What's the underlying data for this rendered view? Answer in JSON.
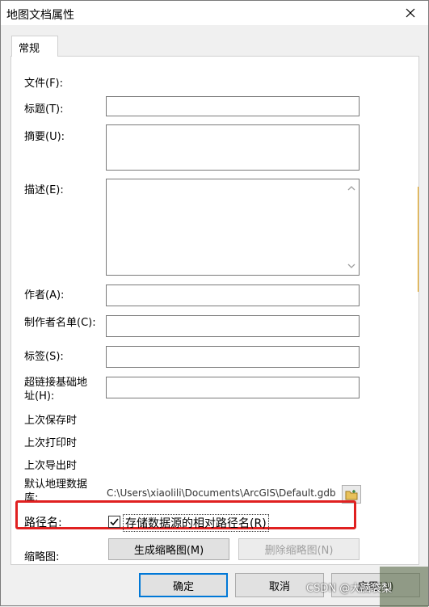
{
  "window": {
    "title": "地图文档属性"
  },
  "tabs": [
    {
      "label": "常规"
    }
  ],
  "form": {
    "file_label": "文件(F):",
    "title_label": "标题(T):",
    "title_value": "",
    "summary_label": "摘要(U):",
    "summary_value": "",
    "description_label": "描述(E):",
    "description_value": "",
    "author_label": "作者(A):",
    "author_value": "",
    "credits_label": "制作者名单(C):",
    "credits_value": "",
    "tags_label": "标签(S):",
    "tags_value": "",
    "hyperlink_label": "超链接基础地址(H):",
    "hyperlink_value": "",
    "last_saved_label": "上次保存时",
    "last_printed_label": "上次打印时",
    "last_exported_label": "上次导出时",
    "default_gdb_label": "默认地理数据库:",
    "default_gdb_value": "C:\\Users\\xiaolili\\Documents\\ArcGIS\\Default.gdb",
    "pathnames_label": "路径名:",
    "relative_paths_label": "存储数据源的相对路径名(R)",
    "relative_paths_checked": true,
    "thumbnail_label": "缩略图:",
    "make_thumbnail_label": "生成缩略图(M)",
    "delete_thumbnail_label": "删除缩略图(N)"
  },
  "buttons": {
    "ok": "确定",
    "cancel": "取消",
    "apply": "应用(A)"
  },
  "watermark": "CSDN @大脑袋梨",
  "colors": {
    "highlight": "#e02020",
    "focus": "#0078d7"
  }
}
